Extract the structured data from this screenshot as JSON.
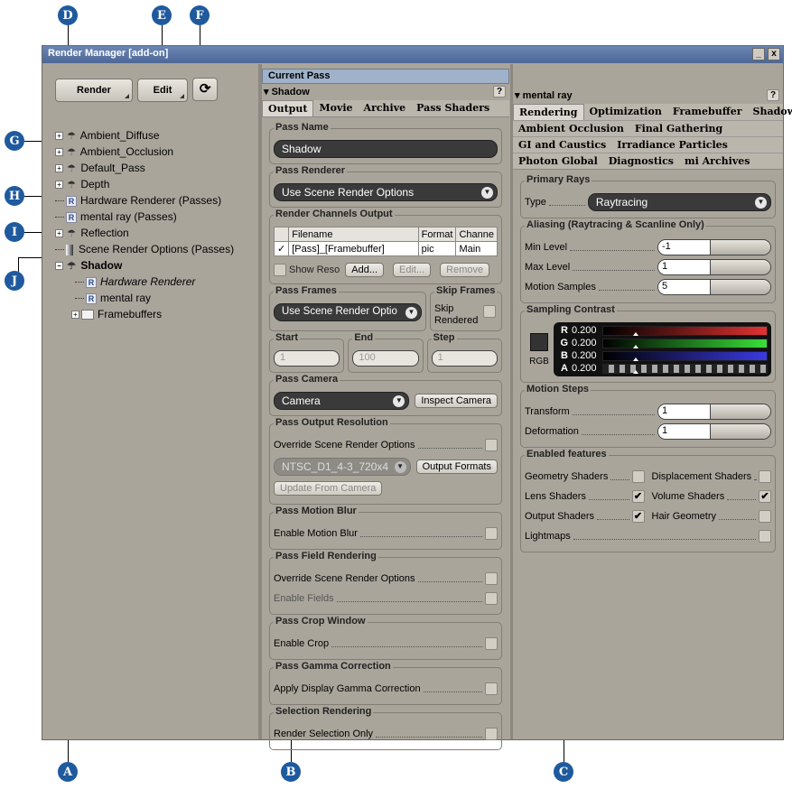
{
  "window": {
    "title": "Render Manager [add-on]",
    "minimize": "_",
    "close": "x"
  },
  "callouts": {
    "a": "A",
    "b": "B",
    "c": "C",
    "d": "D",
    "e": "E",
    "f": "F",
    "g": "G",
    "h": "H",
    "i": "I",
    "j": "J"
  },
  "toolbar": {
    "render_label": "Render",
    "edit_label": "Edit",
    "refresh_icon": "refresh-icon"
  },
  "tree": {
    "ambient_diffuse": "Ambient_Diffuse",
    "ambient_occlusion": "Ambient_Occlusion",
    "default_pass": "Default_Pass",
    "depth": "Depth",
    "hardware_renderer_passes": "Hardware Renderer (Passes)",
    "mental_ray_passes": "mental ray (Passes)",
    "reflection": "Reflection",
    "scene_render_options": "Scene Render Options (Passes)",
    "shadow": "Shadow",
    "hardware_renderer": "Hardware Renderer",
    "mental_ray": "mental ray",
    "framebuffers": "Framebuffers"
  },
  "current_pass": {
    "header": "Current Pass",
    "section": "Shadow",
    "help": "?",
    "tabs": [
      "Output",
      "Movie",
      "Archive",
      "Pass Shaders"
    ],
    "pass_name_title": "Pass Name",
    "pass_name_value": "Shadow",
    "pass_renderer_title": "Pass Renderer",
    "pass_renderer_value": "Use Scene Render Options",
    "channels_title": "Render Channels Output",
    "channels_headers": [
      "Filename",
      "Format",
      "Channe"
    ],
    "channel_row": {
      "check": "✓",
      "filename": "[Pass]_[Framebuffer]",
      "format": "pic",
      "channel": "Main"
    },
    "show_reso": "Show Reso",
    "add_btn": "Add...",
    "edit_btn": "Edit...",
    "remove_btn": "Remove",
    "frames_title": "Pass Frames",
    "frames_value": "Use Scene Render Optio",
    "skip_title": "Skip Frames",
    "skip_label_1": "Skip",
    "skip_label_2": "Rendered",
    "start_title": "Start",
    "start_value": "1",
    "end_title": "End",
    "end_value": "100",
    "step_title": "Step",
    "step_value": "1",
    "camera_title": "Pass Camera",
    "camera_value": "Camera",
    "inspect_camera": "Inspect Camera",
    "resolution_title": "Pass Output Resolution",
    "override_scene": "Override Scene Render Options",
    "resolution_value": "NTSC_D1_4-3_720x4",
    "output_formats": "Output Formats",
    "update_from_camera": "Update From Camera",
    "motion_blur_title": "Pass Motion Blur",
    "enable_motion_blur": "Enable Motion Blur",
    "field_title": "Pass Field Rendering",
    "field_override": "Override Scene Render Options",
    "enable_fields": "Enable Fields",
    "crop_title": "Pass Crop Window",
    "enable_crop": "Enable Crop",
    "gamma_title": "Pass Gamma Correction",
    "apply_gamma": "Apply Display Gamma Correction",
    "selection_title": "Selection Rendering",
    "render_selection_only": "Render Selection Only"
  },
  "mental_ray": {
    "section": "mental ray",
    "help": "?",
    "tabs_row1": [
      "Rendering",
      "Optimization",
      "Framebuffer",
      "Shadows"
    ],
    "tabs_row2": [
      "Ambient Occlusion",
      "Final Gathering"
    ],
    "tabs_row3": [
      "GI and Caustics",
      "Irradiance Particles"
    ],
    "tabs_row4": [
      "Photon Global",
      "Diagnostics",
      "mi Archives"
    ],
    "primary_rays_title": "Primary Rays",
    "type_label": "Type",
    "type_value": "Raytracing",
    "aliasing_title": "Aliasing (Raytracing & Scanline Only)",
    "min_level_label": "Min Level",
    "min_level_value": "-1",
    "max_level_label": "Max Level",
    "max_level_value": "1",
    "motion_samples_label": "Motion Samples",
    "motion_samples_value": "5",
    "sampling_title": "Sampling Contrast",
    "rgb_label": "RGB",
    "channels": [
      {
        "name": "R",
        "value": "0.200",
        "color": "#e23232"
      },
      {
        "name": "G",
        "value": "0.200",
        "color": "#3adf3a"
      },
      {
        "name": "B",
        "value": "0.200",
        "color": "#3a3ae2"
      },
      {
        "name": "A",
        "value": "0.200",
        "color": "#ffffff"
      }
    ],
    "motion_steps_title": "Motion Steps",
    "transform_label": "Transform",
    "transform_value": "1",
    "deformation_label": "Deformation",
    "deformation_value": "1",
    "enabled_title": "Enabled features",
    "geometry_shaders": "Geometry Shaders",
    "displacement_shaders": "Displacement Shaders",
    "lens_shaders": "Lens Shaders",
    "volume_shaders": "Volume Shaders",
    "output_shaders": "Output Shaders",
    "hair_geometry": "Hair Geometry",
    "lightmaps": "Lightmaps",
    "checkmark": "✔"
  }
}
